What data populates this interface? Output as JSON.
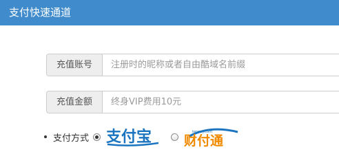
{
  "header": {
    "title": "支付快速通道"
  },
  "form": {
    "account": {
      "label": "充值账号",
      "placeholder": "注册时的昵称或者自由酷域名前缀",
      "value": ""
    },
    "amount": {
      "label": "充值金额",
      "placeholder": "终身VIP费用10元",
      "value": ""
    }
  },
  "payment": {
    "label": "支付方式",
    "options": [
      {
        "name": "alipay",
        "logo_text": "支付宝",
        "selected": true
      },
      {
        "name": "tenpay",
        "logo_text": "财付通",
        "logo_subtext": "tenpay.com",
        "selected": false
      }
    ]
  },
  "colors": {
    "header_bg": "#3f8bcb",
    "alipay_blue": "#1b74bf",
    "tenpay_orange": "#f08a00"
  }
}
